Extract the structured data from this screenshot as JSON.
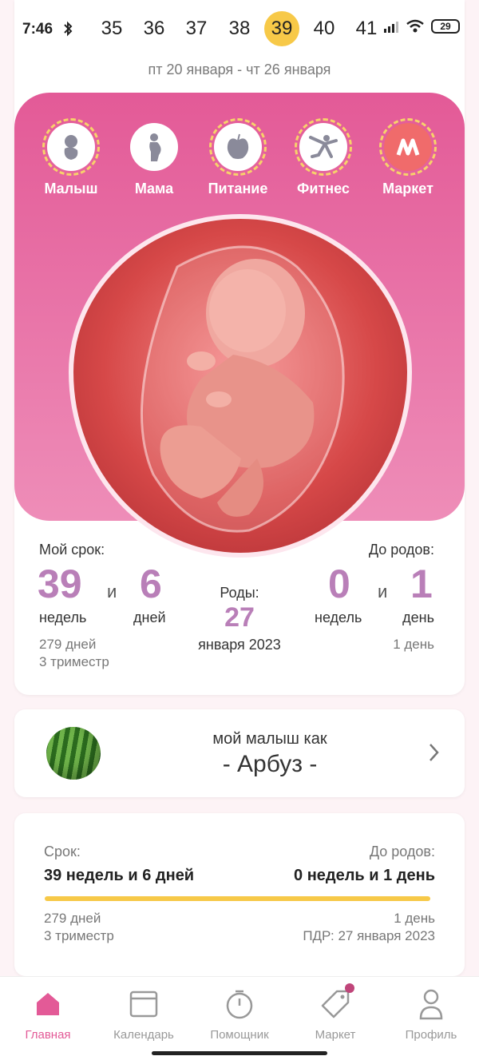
{
  "status": {
    "time": "7:46",
    "battery": "29"
  },
  "weeks": [
    "35",
    "36",
    "37",
    "38",
    "39",
    "40",
    "41"
  ],
  "active_week": "39",
  "date_range": "пт 20 января - чт 26 января",
  "categories": [
    {
      "label": "Малыш",
      "icon": "baby-icon"
    },
    {
      "label": "Мама",
      "icon": "mother-icon"
    },
    {
      "label": "Питание",
      "icon": "apple-icon"
    },
    {
      "label": "Фитнес",
      "icon": "fitness-icon"
    },
    {
      "label": "Маркет",
      "icon": "market-logo-icon"
    }
  ],
  "term": {
    "my_term_label": "Мой срок:",
    "weeks_value": "39",
    "and": "и",
    "days_value": "6",
    "weeks_unit": "недель",
    "days_unit": "дней",
    "total_days": "279 дней",
    "trimester": "3 триместр"
  },
  "birth": {
    "label": "Роды:",
    "day": "27",
    "month_year": "января 2023"
  },
  "until": {
    "label": "До родов:",
    "weeks_value": "0",
    "and": "и",
    "days_value": "1",
    "weeks_unit": "недель",
    "days_unit": "день",
    "days_text": "1 день"
  },
  "fruit": {
    "line1": "мой малыш как",
    "line2": "- Арбуз -",
    "icon": "watermelon-icon"
  },
  "summary": {
    "term_label": "Срок:",
    "term_value": "39 недель и 6 дней",
    "until_label": "До родов:",
    "until_value": "0 недель и 1 день",
    "days": "279 дней",
    "trimester": "3 триместр",
    "until_days": "1 день",
    "pdr": "ПДР: 27 января 2023",
    "progress": 0.99
  },
  "nav": [
    {
      "label": "Главная",
      "icon": "home-icon",
      "active": true
    },
    {
      "label": "Календарь",
      "icon": "calendar-icon",
      "active": false
    },
    {
      "label": "Помощник",
      "icon": "stopwatch-icon",
      "active": false
    },
    {
      "label": "Маркет",
      "icon": "tag-icon",
      "active": false
    },
    {
      "label": "Профиль",
      "icon": "profile-icon",
      "active": false
    }
  ],
  "colors": {
    "accent": "#e35a97",
    "highlight": "#f7c948",
    "numbers": "#b97fb8"
  }
}
